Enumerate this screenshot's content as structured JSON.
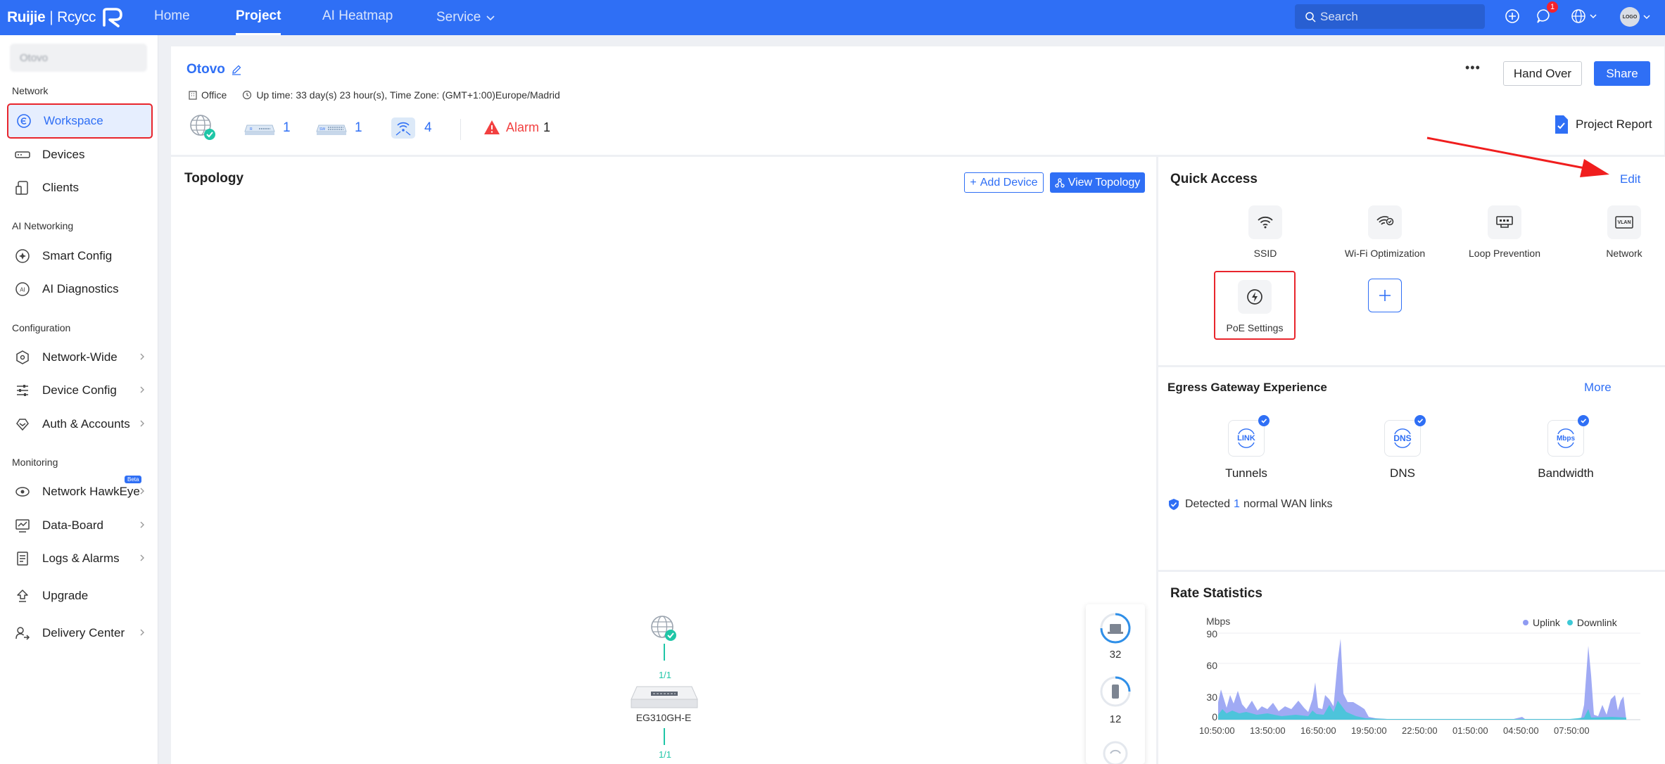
{
  "brand": {
    "name1": "Ruijie",
    "sep": "|",
    "name2": "Rcycc"
  },
  "nav": [
    {
      "label": "Home",
      "active": false
    },
    {
      "label": "Project",
      "active": true
    },
    {
      "label": "AI Heatmap",
      "active": false
    },
    {
      "label": "Service",
      "active": false
    }
  ],
  "search": {
    "placeholder": "Search"
  },
  "notifications": {
    "count": "1"
  },
  "avatar": {
    "text": "LOGO"
  },
  "sidebar": {
    "project_select": "Otovo",
    "sections": [
      {
        "label": "Network",
        "items": [
          {
            "label": "Workspace",
            "icon": "workspace-icon",
            "active": true
          },
          {
            "label": "Devices",
            "icon": "devices-icon"
          },
          {
            "label": "Clients",
            "icon": "clients-icon"
          }
        ]
      },
      {
        "label": "AI Networking",
        "items": [
          {
            "label": "Smart Config",
            "icon": "smart-config-icon"
          },
          {
            "label": "AI Diagnostics",
            "icon": "ai-diagnostics-icon"
          }
        ]
      },
      {
        "label": "Configuration",
        "items": [
          {
            "label": "Network-Wide",
            "icon": "network-wide-icon",
            "chevron": true
          },
          {
            "label": "Device Config",
            "icon": "device-config-icon",
            "chevron": true
          },
          {
            "label": "Auth & Accounts",
            "icon": "auth-icon",
            "chevron": true
          }
        ]
      },
      {
        "label": "Monitoring",
        "items": [
          {
            "label": "Network HawkEye",
            "icon": "hawkeye-icon",
            "chevron": true,
            "badge": "Beta"
          },
          {
            "label": "Data-Board",
            "icon": "data-board-icon",
            "chevron": true
          },
          {
            "label": "Logs & Alarms",
            "icon": "logs-icon",
            "chevron": true
          },
          {
            "label": "Upgrade",
            "icon": "upgrade-icon"
          },
          {
            "label": "Delivery Center",
            "icon": "delivery-icon",
            "chevron": true
          }
        ]
      }
    ]
  },
  "header": {
    "project_name": "Otovo",
    "scene": "Office",
    "uptime": "Up time: 33 day(s) 23 hour(s), Time Zone: (GMT+1:00)Europe/Madrid",
    "gateway_count": "1",
    "switch_count": "1",
    "ap_count": "4",
    "alarm_label": "Alarm",
    "alarm_count": "1",
    "more_label": "•••",
    "hand_over": "Hand Over",
    "share": "Share",
    "project_report": "Project Report"
  },
  "topology": {
    "title": "Topology",
    "add_device": "Add Device",
    "view_topology": "View Topology",
    "wan_link": "1/1",
    "device_name": "EG310GH-E",
    "lan_link": "1/1",
    "side_counts": [
      "32",
      "12"
    ]
  },
  "quick_access": {
    "title": "Quick Access",
    "edit": "Edit",
    "items": [
      {
        "label": "SSID",
        "icon": "wifi-icon"
      },
      {
        "label": "Wi-Fi Optimization",
        "icon": "wifi-optimization-icon"
      },
      {
        "label": "Loop Prevention",
        "icon": "loop-prevention-icon"
      },
      {
        "label": "Network",
        "icon": "vlan-icon"
      },
      {
        "label": "PoE Settings",
        "icon": "poe-icon"
      }
    ],
    "vlan_text": "VLAN"
  },
  "egress": {
    "title": "Egress Gateway Experience",
    "more": "More",
    "items": [
      {
        "label": "Tunnels",
        "icon_text": "LINK"
      },
      {
        "label": "DNS",
        "icon_text": "DNS"
      },
      {
        "label": "Bandwidth",
        "icon_text": "Mbps"
      }
    ],
    "detected_prefix": "Detected",
    "detected_count": "1",
    "detected_suffix": "normal WAN links"
  },
  "rate": {
    "title": "Rate Statistics",
    "unit": "Mbps",
    "legend_up": "Uplink",
    "legend_down": "Downlink",
    "y_ticks": [
      "90",
      "60",
      "30",
      "0"
    ],
    "x_ticks": [
      "10:50:00",
      "13:50:00",
      "16:50:00",
      "19:50:00",
      "22:50:00",
      "01:50:00",
      "04:50:00",
      "07:50:00"
    ],
    "colors": {
      "uplink": "#8f9bf2",
      "downlink": "#3ec9d6"
    }
  }
}
